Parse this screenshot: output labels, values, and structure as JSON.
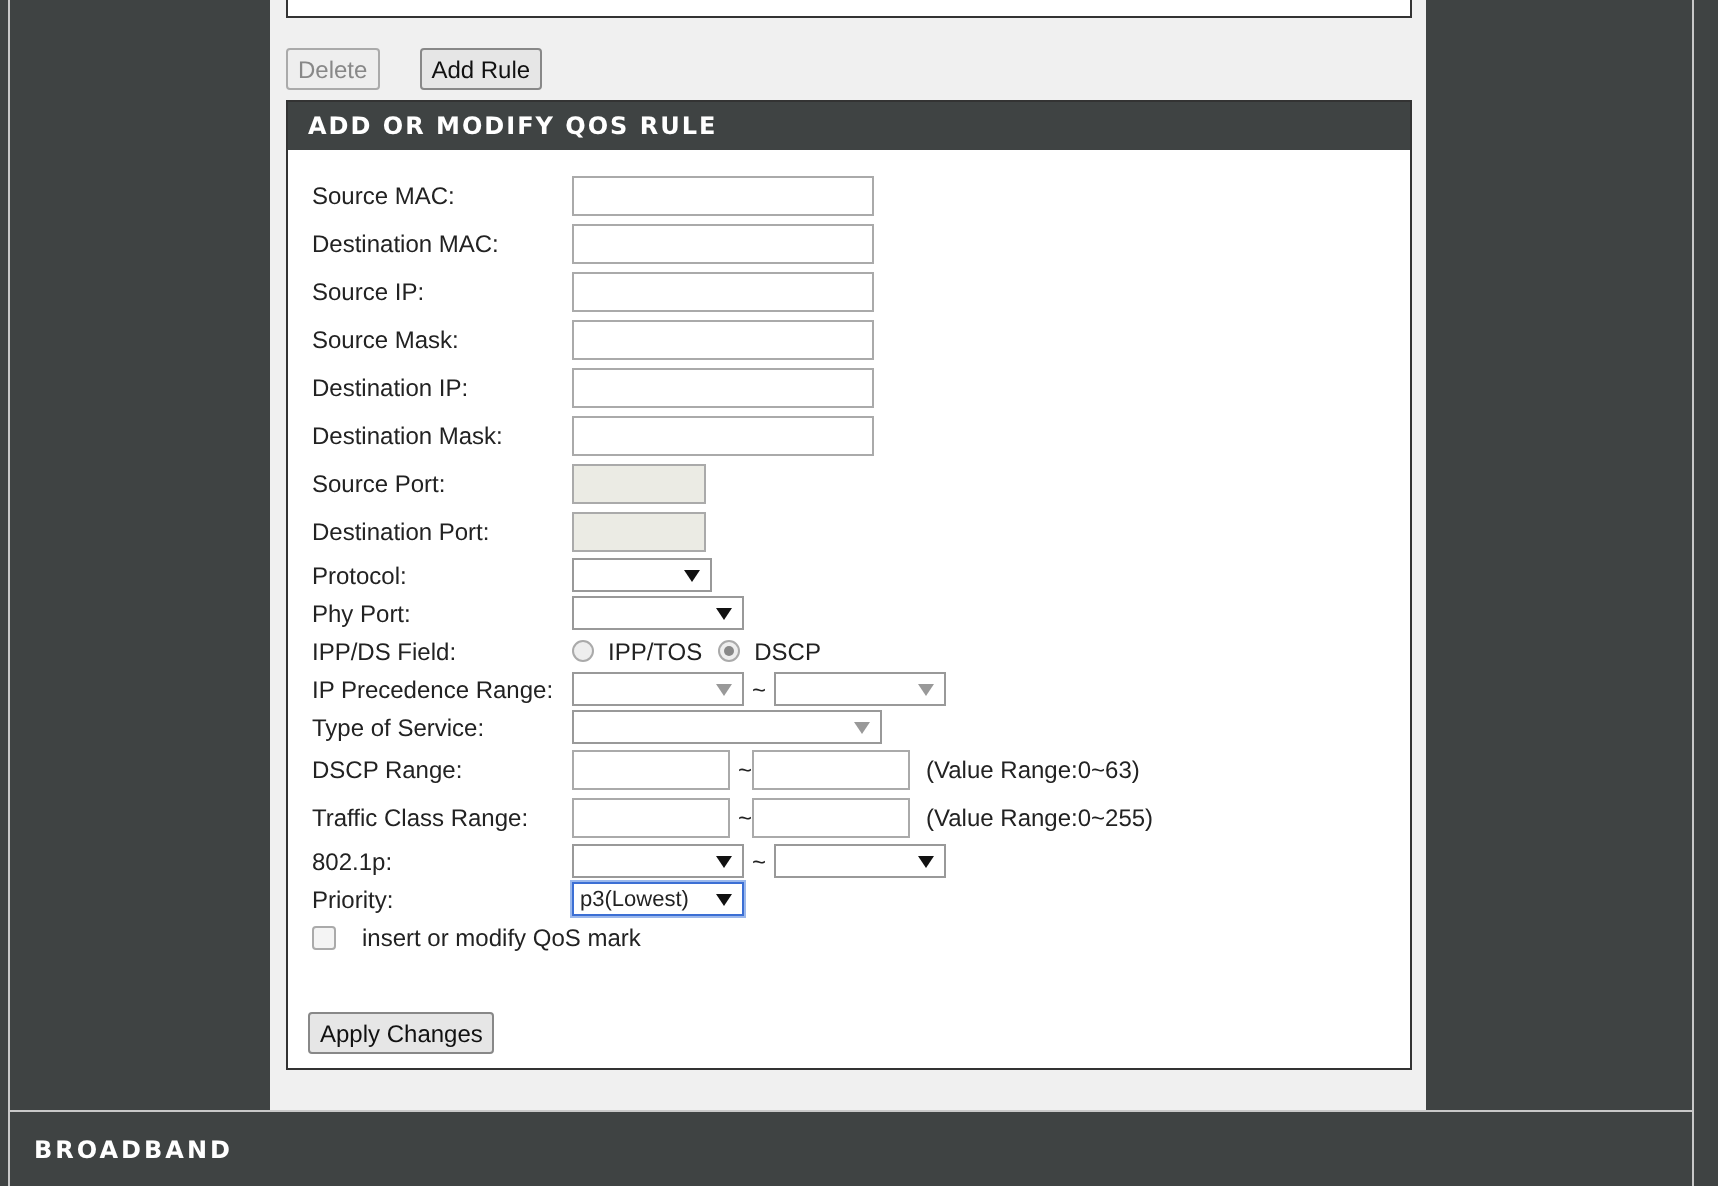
{
  "buttons": [
    {
      "label": "Delete",
      "disabled": true
    },
    {
      "label": "Add Rule",
      "disabled": false
    }
  ],
  "form": {
    "title": "ADD OR MODIFY QOS RULE",
    "rows": [
      {
        "kind": "text",
        "label": "Source MAC:",
        "disabled": false
      },
      {
        "kind": "text",
        "label": "Destination MAC:",
        "disabled": false
      },
      {
        "kind": "text",
        "label": "Source IP:",
        "disabled": false
      },
      {
        "kind": "text",
        "label": "Source Mask:",
        "disabled": false
      },
      {
        "kind": "text",
        "label": "Destination IP:",
        "disabled": false
      },
      {
        "kind": "text",
        "label": "Destination Mask:",
        "disabled": false
      },
      {
        "kind": "text",
        "label": "Source Port:",
        "disabled": true
      },
      {
        "kind": "text",
        "label": "Destination Port:",
        "disabled": true
      },
      {
        "kind": "select",
        "label": "Protocol:",
        "disabled": false,
        "focused": false
      },
      {
        "kind": "select",
        "label": "Phy Port:",
        "disabled": false,
        "focused": false
      },
      {
        "kind": "radio",
        "label": "IPP/DS Field:",
        "options": [
          {
            "label": "IPP/TOS",
            "selected": false
          },
          {
            "label": "DSCP",
            "selected": true
          }
        ]
      },
      {
        "kind": "range_select",
        "label": "IP Precedence Range:",
        "separator": "~",
        "disabled": true
      },
      {
        "kind": "select",
        "label": "Type of Service:",
        "disabled": true,
        "focused": false
      },
      {
        "kind": "range_text",
        "label": "DSCP Range:",
        "separator": "~",
        "note": "(Value Range:0~63)"
      },
      {
        "kind": "range_text",
        "label": "Traffic Class Range:",
        "separator": "~",
        "note": "(Value Range:0~255)"
      },
      {
        "kind": "range_select",
        "label": "802.1p:",
        "separator": "~",
        "disabled": false
      },
      {
        "kind": "select",
        "label": "Priority:",
        "value": "p3(Lowest)",
        "disabled": false,
        "focused": true
      },
      {
        "kind": "checkbox",
        "label": "insert or modify QoS mark",
        "checked": false
      }
    ],
    "apply_button": "Apply Changes"
  },
  "footer": {
    "brand": "BROADBAND"
  }
}
